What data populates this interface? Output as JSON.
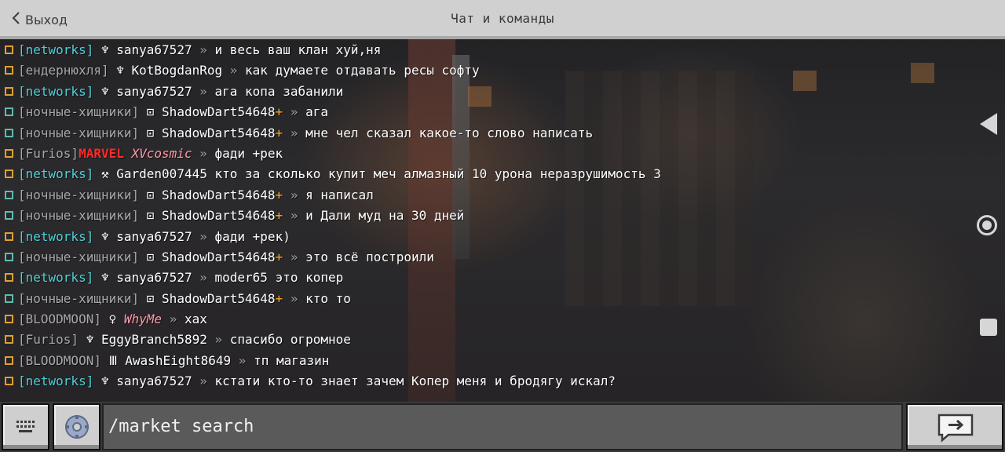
{
  "header": {
    "back_label": "Выход",
    "title": "Чат и команды"
  },
  "messages": [
    {
      "dot": "amber",
      "clan": "[networks]",
      "clan_color": "c-net",
      "sym": "♆",
      "name": "sanya67527",
      "name_color": "c-white",
      "plus": "",
      "sep": "»",
      "text": " и весь ваш клан хуй,ня"
    },
    {
      "dot": "amber",
      "clan": "[ендернюхля]",
      "clan_color": "c-gray",
      "sym": "♆",
      "name": "KotBogdanRog",
      "name_color": "c-white",
      "plus": "",
      "sep": "»",
      "text": "как думаете отдавать ресы софту"
    },
    {
      "dot": "amber",
      "clan": "[networks]",
      "clan_color": "c-net",
      "sym": "♆",
      "name": "sanya67527",
      "name_color": "c-white",
      "plus": "",
      "sep": "»",
      "text": " ага копа забанили"
    },
    {
      "dot": "teal",
      "clan": "[ночные-хищники]",
      "clan_color": "c-gray",
      "sym": "⊡",
      "name": "ShadowDart54648",
      "name_color": "c-white",
      "plus": "+",
      "sep": "»",
      "text": "ага"
    },
    {
      "dot": "teal",
      "clan": "[ночные-хищники]",
      "clan_color": "c-gray",
      "sym": "⊡",
      "name": "ShadowDart54648",
      "name_color": "c-white",
      "plus": "+",
      "sep": "»",
      "text": "мне чел сказал какое-то слово написать"
    },
    {
      "dot": "amber",
      "clan": "[Furios]",
      "clan_color": "c-gray",
      "marvel": "MARVEL",
      "sym": "",
      "name": "XVcosmic",
      "name_color": "c-pink",
      "plus": "",
      "sep": "»",
      "text": " фади +рек"
    },
    {
      "dot": "amber",
      "clan": "[networks]",
      "clan_color": "c-net",
      "sym": "⚒",
      "name": "Garden007445",
      "name_color": "c-white",
      "plus": "",
      "sep": "",
      "text": " кто за сколько купит меч алмазный 10 урона неразрушимость 3"
    },
    {
      "dot": "teal",
      "clan": "[ночные-хищники]",
      "clan_color": "c-gray",
      "sym": "⊡",
      "name": "ShadowDart54648",
      "name_color": "c-white",
      "plus": "+",
      "sep": "»",
      "text": "я написал"
    },
    {
      "dot": "teal",
      "clan": "[ночные-хищники]",
      "clan_color": "c-gray",
      "sym": "⊡",
      "name": "ShadowDart54648",
      "name_color": "c-white",
      "plus": "+",
      "sep": "»",
      "text": "и Дали муд на 30 дней"
    },
    {
      "dot": "amber",
      "clan": "[networks]",
      "clan_color": "c-net",
      "sym": "♆",
      "name": "sanya67527",
      "name_color": "c-white",
      "plus": "",
      "sep": "»",
      "text": " фади +рек)"
    },
    {
      "dot": "teal",
      "clan": "[ночные-хищники]",
      "clan_color": "c-gray",
      "sym": "⊡",
      "name": "ShadowDart54648",
      "name_color": "c-white",
      "plus": "+",
      "sep": "»",
      "text": "это всё построили"
    },
    {
      "dot": "amber",
      "clan": "[networks]",
      "clan_color": "c-net",
      "sym": "♆",
      "name": "sanya67527",
      "name_color": "c-white",
      "plus": "",
      "sep": "»",
      "text": " moder65 это копер"
    },
    {
      "dot": "teal",
      "clan": "[ночные-хищники]",
      "clan_color": "c-gray",
      "sym": "⊡",
      "name": "ShadowDart54648",
      "name_color": "c-white",
      "plus": "+",
      "sep": "»",
      "text": "кто то"
    },
    {
      "dot": "amber",
      "clan": "[BLOODMOON]",
      "clan_color": "c-gray",
      "sym": "♀",
      "name": "WhyMe",
      "name_color": "c-pink",
      "plus": "",
      "sep": "»",
      "text": " хах"
    },
    {
      "dot": "amber",
      "clan": "[Furios]",
      "clan_color": "c-gray",
      "sym": "♆",
      "name": "EggyBranch5892",
      "name_color": "c-white",
      "plus": "",
      "sep": "»",
      "text": "спасибо огромное"
    },
    {
      "dot": "amber",
      "clan": "[BLOODMOON]",
      "clan_color": "c-gray",
      "sym": "Ⅲ",
      "name": "AwashEight8649",
      "name_color": "c-white",
      "plus": "",
      "sep": "»",
      "text": " тп магазин"
    },
    {
      "dot": "amber",
      "clan": "[networks]",
      "clan_color": "c-net",
      "sym": "♆",
      "name": "sanya67527",
      "name_color": "c-white",
      "plus": "",
      "sep": "»",
      "text": " кстати кто-то знает зачем Копер меня и бродягу искал?"
    }
  ],
  "input": {
    "value": "/market search"
  },
  "colors": {
    "header_bg": "#d0d0d0",
    "input_bg": "#5a5a5a",
    "button_bg": "#cfcfcf",
    "clan_networks": "#4cd0d8",
    "marvel_red": "#ff2a2a",
    "plus_gold": "#ffaa22"
  },
  "icons": {
    "back": "chevron-left-icon",
    "keyboard": "keyboard-icon",
    "emote": "emote-gear-icon",
    "send": "send-arrow-icon"
  }
}
